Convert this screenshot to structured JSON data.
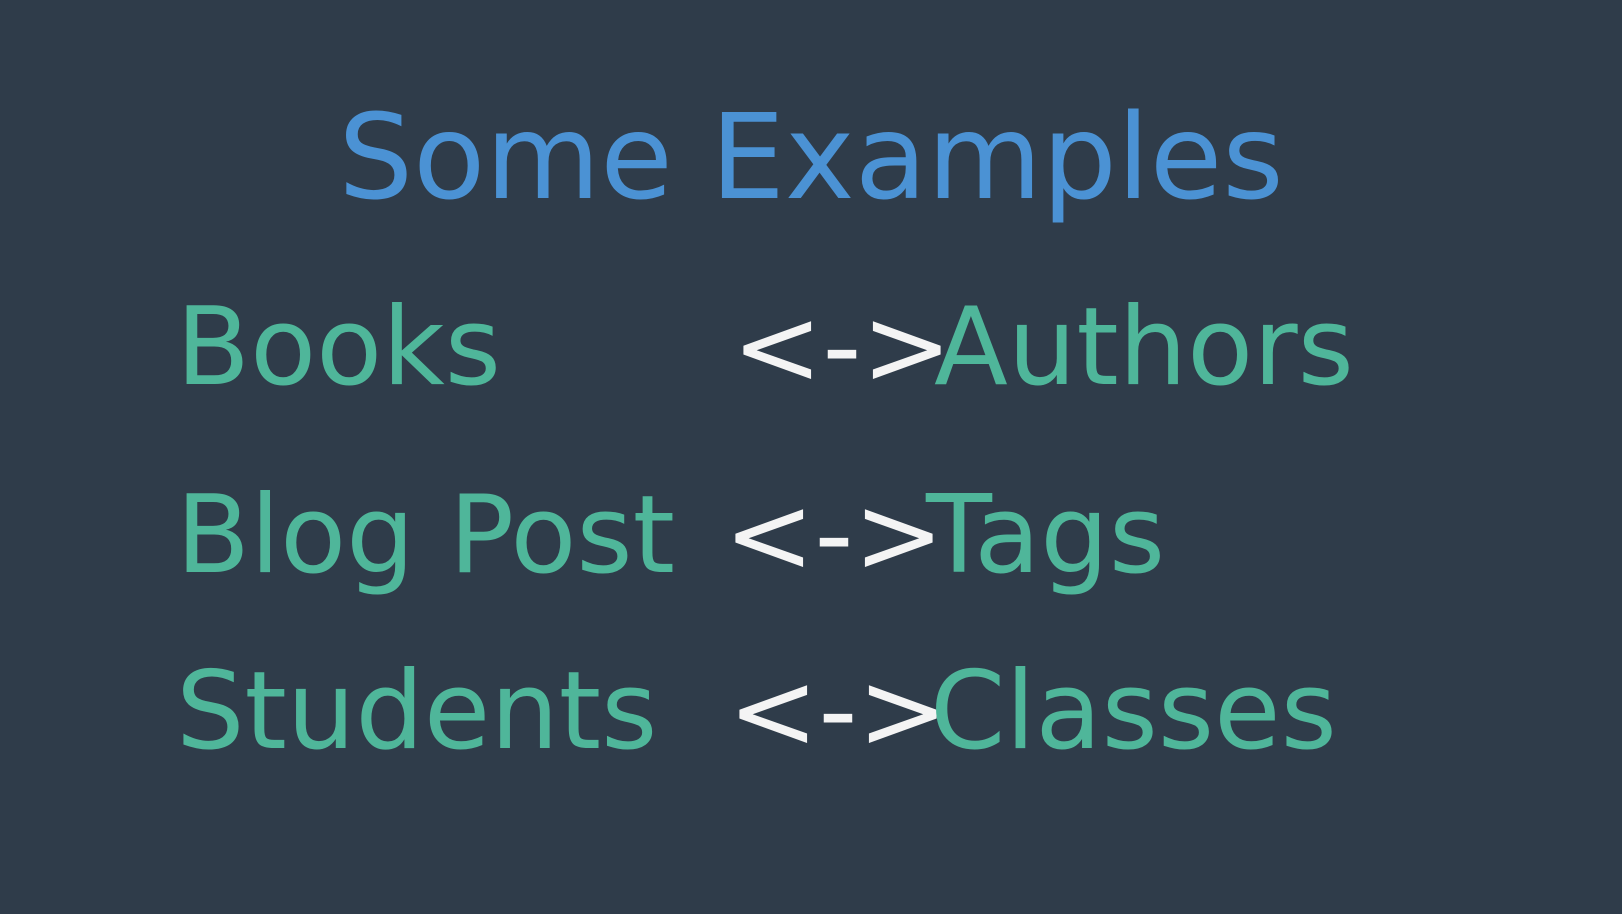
{
  "title": "Some Examples",
  "relationships": [
    {
      "left": "Books",
      "arrow": "<->",
      "right": "Authors"
    },
    {
      "left": "Blog Post",
      "arrow": "<->",
      "right": "Tags"
    },
    {
      "left": "Students",
      "arrow": "<->",
      "right": "Classes"
    }
  ],
  "colors": {
    "background": "#2f3c4a",
    "title": "#4b92d4",
    "term": "#4fb69a",
    "arrow": "#f4f4f4"
  }
}
